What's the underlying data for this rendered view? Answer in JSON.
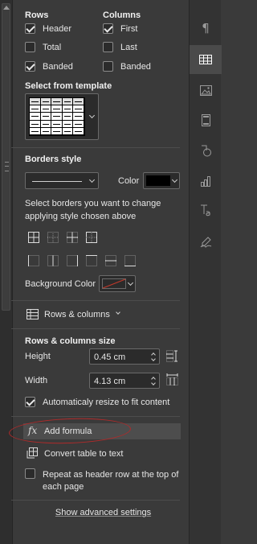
{
  "rows": {
    "title": "Rows",
    "header": {
      "label": "Header",
      "checked": true
    },
    "total": {
      "label": "Total",
      "checked": false
    },
    "banded": {
      "label": "Banded",
      "checked": true
    }
  },
  "columns": {
    "title": "Columns",
    "first": {
      "label": "First",
      "checked": true
    },
    "last": {
      "label": "Last",
      "checked": false
    },
    "banded": {
      "label": "Banded",
      "checked": false
    }
  },
  "template": {
    "title": "Select from template"
  },
  "borders": {
    "title": "Borders style",
    "color_label": "Color",
    "color_value": "#000000",
    "hint": "Select borders you want to change applying style chosen above"
  },
  "background": {
    "label": "Background Color",
    "value": "none"
  },
  "rows_columns": {
    "label": "Rows & columns"
  },
  "size": {
    "title": "Rows & columns size",
    "height_label": "Height",
    "height_value": "0.45 cm",
    "width_label": "Width",
    "width_value": "4.13 cm",
    "autoresize": {
      "label": "Automaticaly resize to fit content",
      "checked": true
    }
  },
  "actions": {
    "add_formula": "Add formula",
    "convert": "Convert table to text",
    "repeat_header": {
      "label": "Repeat as header row at the top of each page",
      "checked": false
    }
  },
  "advanced": {
    "label": "Show advanced settings"
  },
  "annotation_color": "#b02a2a",
  "right_toolbar": [
    "paragraph-icon",
    "table-icon",
    "image-icon",
    "header-footer-icon",
    "shape-icon",
    "chart-icon",
    "text-art-icon",
    "signature-icon"
  ]
}
